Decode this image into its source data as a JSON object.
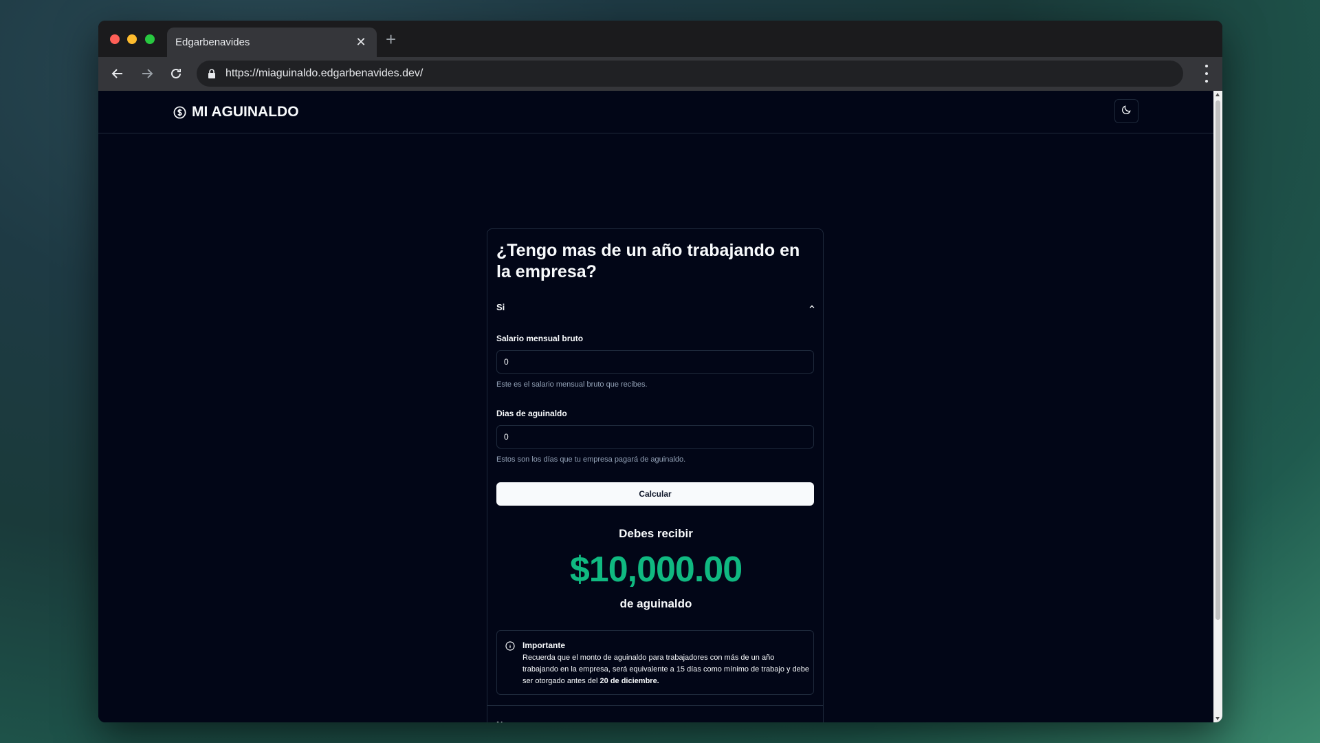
{
  "browser": {
    "tab_title": "Edgarbenavides",
    "url": "https://miaguinaldo.edgarbenavides.dev/"
  },
  "site": {
    "brand": "MI AGUINALDO"
  },
  "card": {
    "title": "¿Tengo mas de un año trabajando en la empresa?",
    "section_si": "Si",
    "section_no": "No",
    "salary_label": "Salario mensual bruto",
    "salary_value": "0",
    "salary_hint": "Este es el salario mensual bruto que recibes.",
    "days_label": "Dias de aguinaldo",
    "days_value": "0",
    "days_hint": "Estos son los días que tu empresa pagará de aguinaldo.",
    "calc_button": "Calcular",
    "result_pre": "Debes recibir",
    "result_amount": "$10,000.00",
    "result_post": "de aguinaldo",
    "alert_title": "Importante",
    "alert_body": "Recuerda que el monto de aguinaldo para trabajadores con más de un año trabajando en la empresa, será equivalente a 15 días como mínimo de trabajo y debe ser otorgado antes del ",
    "alert_bold": "20 de diciembre."
  },
  "colors": {
    "accent_green": "#10b981",
    "page_bg": "#020617"
  }
}
